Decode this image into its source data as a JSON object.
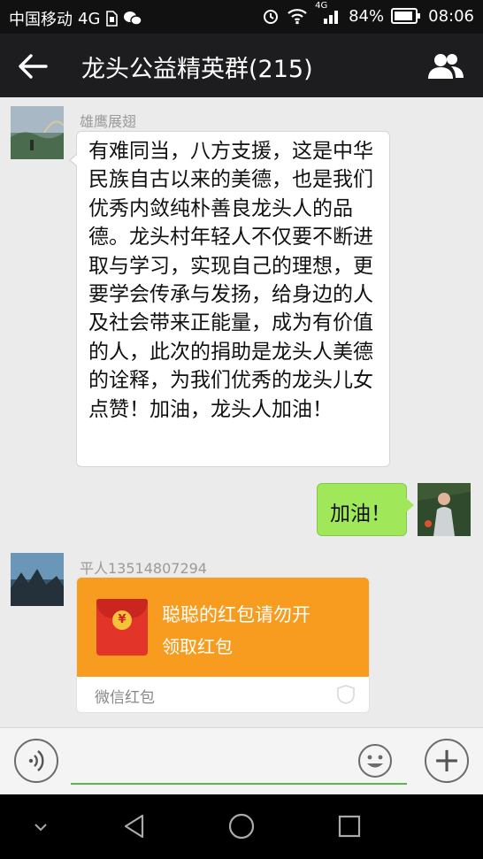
{
  "status": {
    "carrier": "中国移动",
    "network": "4G",
    "signal_network": "4G",
    "battery": "84%",
    "time": "08:06"
  },
  "header": {
    "title": "龙头公益精英群(215)"
  },
  "messages": [
    {
      "sender": "雄鹰展翅",
      "text": "有难同当，八方支援，这是中华民族自古以来的美德，也是我们优秀内敛纯朴善良龙头人的品德。龙头村年轻人不仅要不断进取与学习，实现自己的理想，更要学会传承与发扬，给身边的人及社会带来正能量，成为有价值的人，此次的捐助是龙头人美德的诠释，为我们优秀的龙头儿女点赞！加油，龙头人加油！"
    },
    {
      "sender": "",
      "text": "加油！"
    },
    {
      "sender": "平人13514807294",
      "red_packet": {
        "title": "聪聪的红包请勿开",
        "action": "领取红包",
        "footer": "微信红包"
      }
    }
  ],
  "colors": {
    "status_bar": "#111111",
    "nav_bar": "#1d1d1f",
    "chat_bg": "#ebebeb",
    "my_bubble": "#a0e75a",
    "red_packet": "#f79c1e",
    "input_underline": "#58b94a"
  }
}
